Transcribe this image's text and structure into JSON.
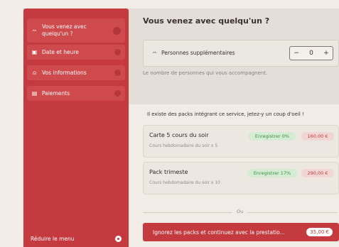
{
  "sidebar": {
    "items": [
      {
        "label": "Vous venez avec quelqu'un ?",
        "icon": "people-icon"
      },
      {
        "label": "Date et heure",
        "icon": "calendar-icon"
      },
      {
        "label": "Vos informations",
        "icon": "user-icon"
      },
      {
        "label": "Paiements",
        "icon": "card-icon"
      }
    ],
    "reduce_label": "Réduire le menu"
  },
  "main": {
    "title": "Vous venez avec quelqu'un ?",
    "persons_label": "Personnes supplémentaires",
    "stepper": {
      "minus": "−",
      "value": "0",
      "plus": "+"
    },
    "hint": "Le nombre de personnes qui vous accompagnent.",
    "packs_intro": "Il existe des packs intégrant ce service, jetez-y un coup d'oeil !",
    "packs": [
      {
        "name": "Carte 5 cours du soir",
        "desc": "Cours hebdomadaire du soir x 5",
        "save": "Enregistrer 0%",
        "price": "160,00 €"
      },
      {
        "name": "Pack trimeste",
        "desc": "Cours hebdomadaire du soir x 10",
        "save": "Enregistrer 17%",
        "price": "290,00 €"
      }
    ],
    "or_label": "Ou",
    "ignore_label": "Ignorez les packs et continuez avec la prestatio...",
    "ignore_price": "35,00 €"
  },
  "colors": {
    "accent": "#c43a3e",
    "save_green": "#3d8f45",
    "background": "#f1ece6"
  }
}
